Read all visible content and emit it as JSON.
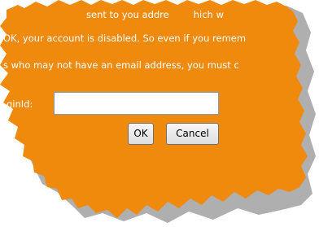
{
  "colors": {
    "panel": "#f08a0c",
    "shadow": "#6e6e6e",
    "text": "#ffffff"
  },
  "dialog": {
    "line1_a": "sent to you",
    "line1_b": "addre",
    "line1_c": "hich w",
    "line2": "OK, your account is disabled. So even if you remem",
    "line3": "s who may not have an email address, you must c",
    "login_label": "ginId:",
    "login_value": "",
    "ok_label": "OK",
    "cancel_label": "Cancel"
  }
}
